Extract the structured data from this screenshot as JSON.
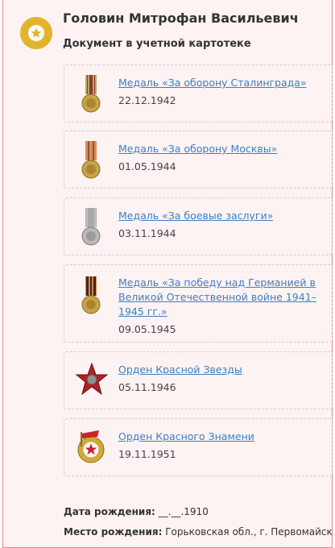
{
  "person": {
    "name": "Головин Митрофан Васильевич",
    "document_label": "Документ в учетной картотеке"
  },
  "awards": [
    {
      "title": "Медаль «За оборону Сталинграда»",
      "date": "22.12.1942",
      "icon": "stalingrad-medal-icon"
    },
    {
      "title": "Медаль «За оборону Москвы»",
      "date": "01.05.1944",
      "icon": "moscow-medal-icon"
    },
    {
      "title": "Медаль «За боевые заслуги»",
      "date": "03.11.1944",
      "icon": "combat-merit-medal-icon"
    },
    {
      "title": "Медаль «За победу над Германией в Великой Отечественной войне 1941–1945 гг.»",
      "date": "09.05.1945",
      "icon": "victory-medal-icon"
    },
    {
      "title": "Орден Красной Звезды",
      "date": "05.11.1946",
      "icon": "red-star-order-icon"
    },
    {
      "title": "Орден Красного Знамени",
      "date": "19.11.1951",
      "icon": "red-banner-order-icon"
    }
  ],
  "details": {
    "birth_date_label": "Дата рождения:",
    "birth_date_value": "__.__.1910",
    "birth_place_label": "Место рождения:",
    "birth_place_value": "Горьковская обл., г. Первомайск"
  },
  "colors": {
    "accent_border": "#e28b8b",
    "card_background": "#fdf3f3",
    "link": "#3b7fc4",
    "badge": "#e3b42b"
  }
}
